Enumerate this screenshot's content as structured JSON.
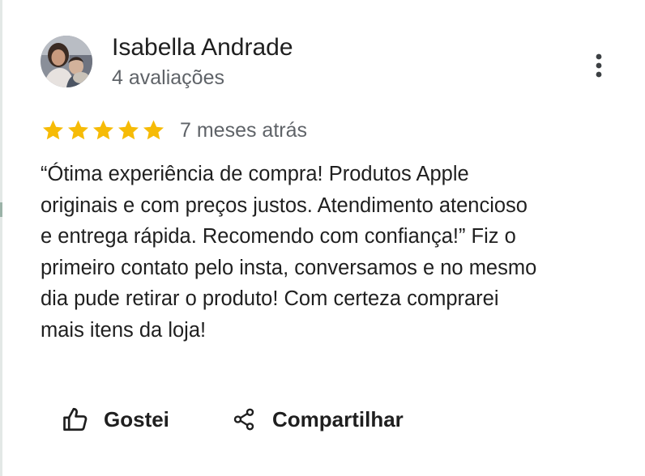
{
  "reviewer": {
    "name": "Isabella Andrade",
    "review_count": "4 avaliações",
    "avatar": "profile-photo"
  },
  "menu": {
    "icon": "more-vert-icon"
  },
  "review": {
    "rating": 5,
    "rating_max": 5,
    "star_color": "#f6bb06",
    "time_ago": "7 meses atrás",
    "text": "“Ótima experiência de compra! Produtos Apple\noriginais e com preços justos. Atendimento atencioso\ne entrega rápida. Recomendo com confiança!” Fiz o\nprimeiro contato pelo insta, conversamos e no mesmo\ndia pude retirar o produto! Com certeza comprarei\nmais itens da loja!"
  },
  "actions": {
    "like_label": "Gostei",
    "like_icon": "thumb-up-icon",
    "share_label": "Compartilhar",
    "share_icon": "share-icon"
  }
}
